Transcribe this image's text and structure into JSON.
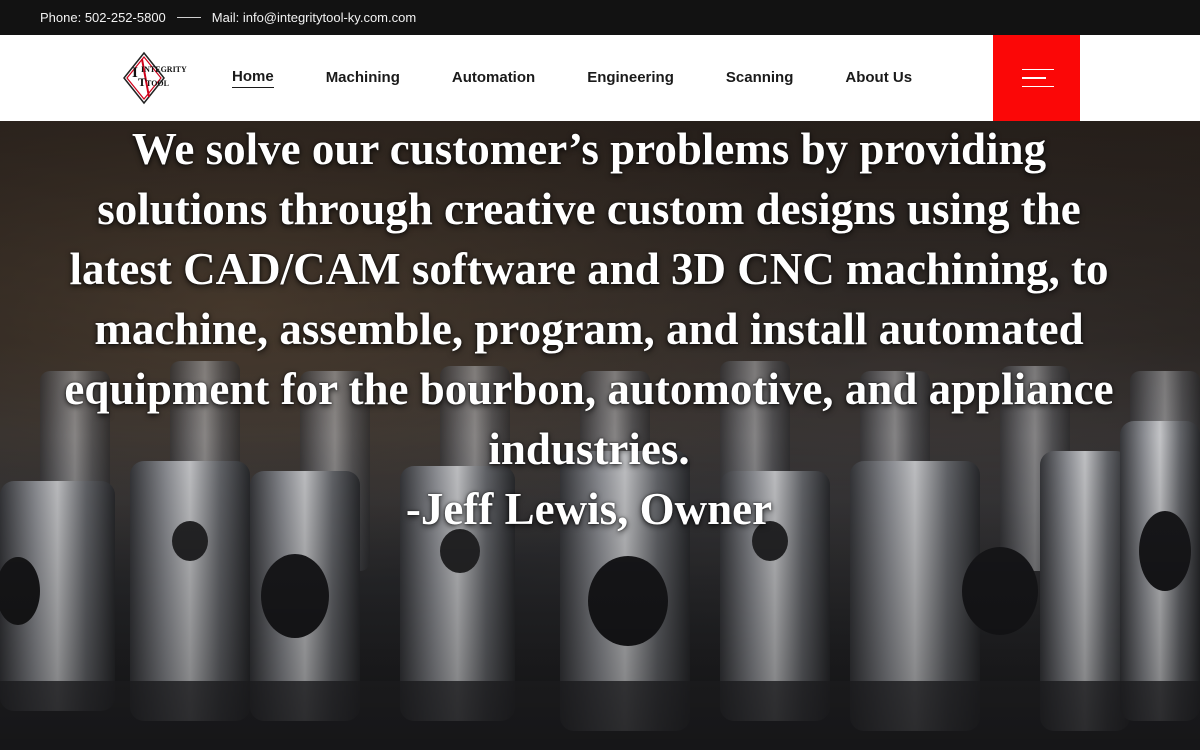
{
  "topbar": {
    "phone": "Phone: 502-252-5800",
    "mail": "Mail: info@integritytool-ky.com.com"
  },
  "header": {
    "logo": {
      "line1": "INTEGRITY",
      "line2": "TOOL",
      "accent_color": "#d0021b"
    },
    "nav": [
      {
        "label": "Home",
        "active": true
      },
      {
        "label": "Machining"
      },
      {
        "label": "Automation"
      },
      {
        "label": "Engineering"
      },
      {
        "label": "Scanning"
      },
      {
        "label": "About Us"
      }
    ],
    "menu_icon": "hamburger-icon",
    "menu_color": "#fb0707"
  },
  "hero": {
    "quote": "We solve our customer’s problems by providing solutions through creative custom designs using the latest CAD/CAM software and 3D CNC machining, to machine, assemble, program, and install automated equipment for the bourbon, automotive, and appliance industries.",
    "author": "-Jeff Lewis, Owner"
  }
}
